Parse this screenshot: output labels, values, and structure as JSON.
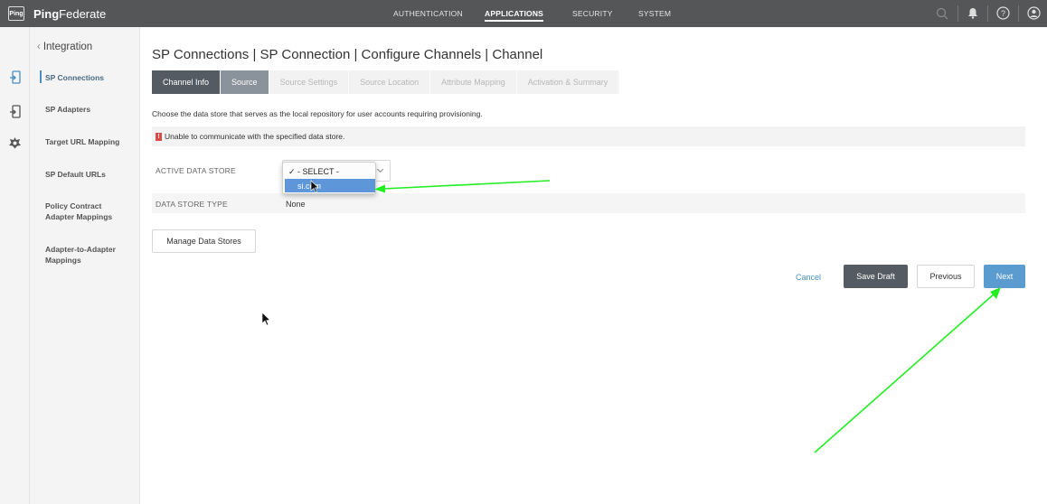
{
  "brand": {
    "logo_text": "Ping",
    "name_bold": "Ping",
    "name_rest": "Federate"
  },
  "nav": [
    {
      "label": "AUTHENTICATION"
    },
    {
      "label": "APPLICATIONS"
    },
    {
      "label": "SECURITY"
    },
    {
      "label": "SYSTEM"
    }
  ],
  "top_icons": [
    "search-icon",
    "bell-icon",
    "help-icon",
    "user-icon"
  ],
  "rail_icons": [
    "sp-connections-icon",
    "sp-adapters-icon",
    "target-url-icon"
  ],
  "sidebar": {
    "back": "Integration",
    "items": [
      {
        "label": "SP Connections"
      },
      {
        "label": "SP Adapters"
      },
      {
        "label": "Target URL Mapping"
      },
      {
        "label": "SP Default URLs"
      },
      {
        "label": "Policy Contract Adapter Mappings"
      },
      {
        "label": "Adapter-to-Adapter Mappings"
      }
    ]
  },
  "title": "SP Connections | SP Connection | Configure Channels | Channel",
  "tabs": [
    {
      "label": "Channel Info"
    },
    {
      "label": "Source"
    },
    {
      "label": "Source Settings"
    },
    {
      "label": "Source Location"
    },
    {
      "label": "Attribute Mapping"
    },
    {
      "label": "Activation & Summary"
    }
  ],
  "description": "Choose the data store that serves as the local repository for user accounts requiring provisioning.",
  "error_message": "Unable to communicate with the specified data store.",
  "fields": {
    "active_data_store": "ACTIVE DATA STORE",
    "data_store_type": "DATA STORE TYPE",
    "data_store_type_value": "None"
  },
  "dropdown": {
    "options": [
      {
        "label": "✓ - SELECT -"
      },
      {
        "label": "si.com"
      }
    ]
  },
  "buttons": {
    "manage": "Manage Data Stores",
    "cancel": "Cancel",
    "save_draft": "Save Draft",
    "previous": "Previous",
    "next": "Next"
  },
  "colors": {
    "topbar": "#555658",
    "accent": "#5a9bd0",
    "annotation_arrow": "#22ee22",
    "error": "#d94b45"
  }
}
